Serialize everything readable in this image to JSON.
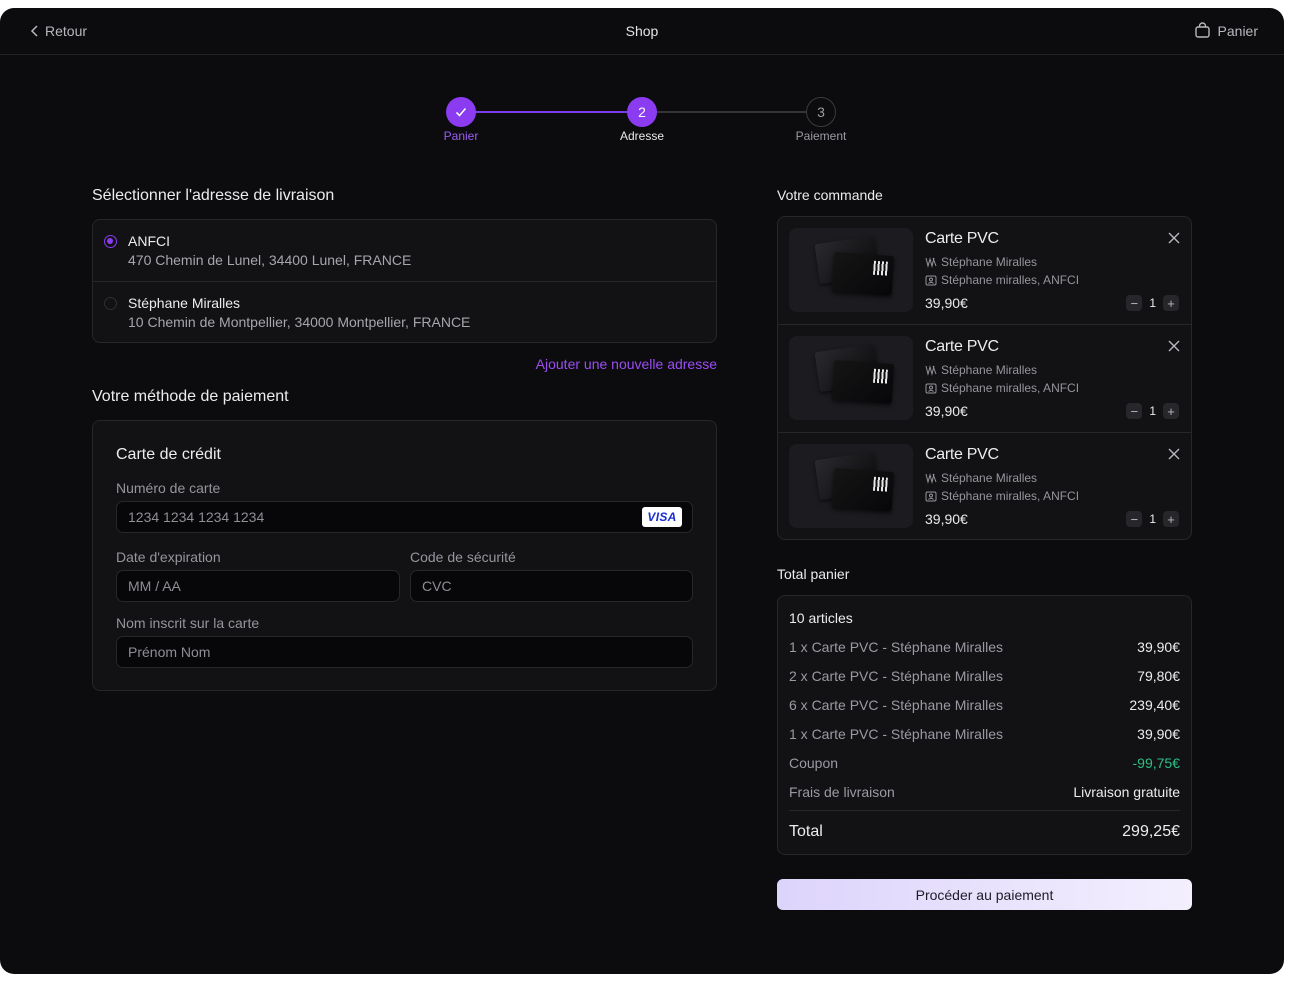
{
  "header": {
    "back_label": "Retour",
    "title": "Shop",
    "cart_label": "Panier"
  },
  "stepper": {
    "steps": [
      {
        "label": "Panier",
        "number": "1",
        "state": "done"
      },
      {
        "label": "Adresse",
        "number": "2",
        "state": "current"
      },
      {
        "label": "Paiement",
        "number": "3",
        "state": "upcoming"
      }
    ]
  },
  "address": {
    "title": "Sélectionner l'adresse de livraison",
    "options": [
      {
        "name": "ANFCI",
        "line": "470 Chemin de Lunel, 34400 Lunel, FRANCE",
        "selected": true
      },
      {
        "name": "Stéphane Miralles",
        "line": "10 Chemin de Montpellier, 34000 Montpellier, FRANCE",
        "selected": false
      }
    ],
    "add_label": "Ajouter une nouvelle adresse"
  },
  "payment": {
    "title": "Votre méthode de paiement",
    "card_title": "Carte de crédit",
    "card_number_label": "Numéro de carte",
    "card_number_placeholder": "1234 1234 1234 1234",
    "card_brand": "VISA",
    "expiry_label": "Date d'expiration",
    "expiry_placeholder": "MM / AA",
    "cvc_label": "Code de sécurité",
    "cvc_placeholder": "CVC",
    "name_label": "Nom inscrit sur la carte",
    "name_placeholder": "Prénom Nom"
  },
  "order": {
    "title": "Votre commande",
    "items": [
      {
        "name": "Carte PVC",
        "holder": "Stéphane Miralles",
        "company": "Stéphane miralles, ANFCI",
        "price": "39,90€",
        "qty": "1"
      },
      {
        "name": "Carte PVC",
        "holder": "Stéphane Miralles",
        "company": "Stéphane miralles, ANFCI",
        "price": "39,90€",
        "qty": "1"
      },
      {
        "name": "Carte PVC",
        "holder": "Stéphane Miralles",
        "company": "Stéphane miralles, ANFCI",
        "price": "39,90€",
        "qty": "1"
      }
    ]
  },
  "totals": {
    "title": "Total panier",
    "count": "10 articles",
    "lines": [
      {
        "label": "1 x Carte PVC - Stéphane Miralles",
        "value": "39,90€"
      },
      {
        "label": "2 x Carte PVC - Stéphane Miralles",
        "value": "79,80€"
      },
      {
        "label": "6 x Carte PVC - Stéphane Miralles",
        "value": "239,40€"
      },
      {
        "label": "1 x Carte PVC - Stéphane Miralles",
        "value": "39,90€"
      }
    ],
    "coupon_label": "Coupon",
    "coupon_value": "-99,75€",
    "shipping_label": "Frais de livraison",
    "shipping_value": "Livraison gratuite",
    "total_label": "Total",
    "total_value": "299,25€"
  },
  "cta": {
    "label": "Procéder au paiement"
  },
  "colors": {
    "accent": "#8b3cf0",
    "background": "#0c0c0e",
    "panel": "#121215",
    "discount": "#2dbf85"
  }
}
